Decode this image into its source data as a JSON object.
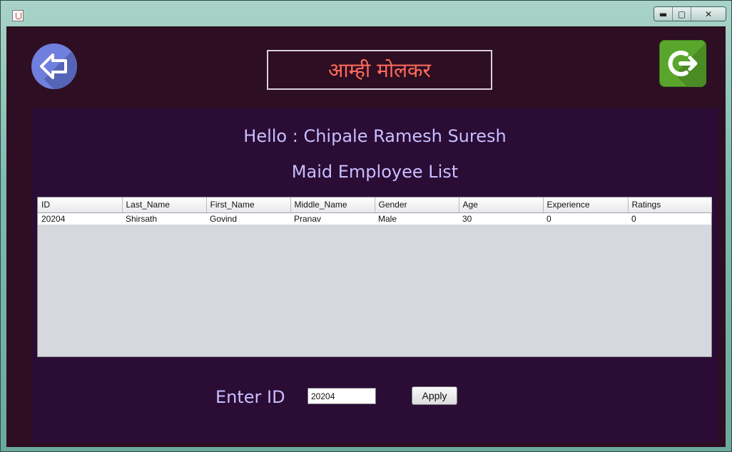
{
  "window": {
    "controls": {
      "minimize": "▬",
      "maximize": "▢",
      "close": "✕"
    },
    "accent_bg": "#2e0e22"
  },
  "header": {
    "title": "आम्ही मोलकर",
    "back_icon": "back-arrow-icon",
    "exit_icon": "exit-power-icon"
  },
  "main": {
    "greeting": "Hello : Chipale Ramesh Suresh",
    "list_title": "Maid Employee List",
    "table": {
      "columns": [
        "ID",
        "Last_Name",
        "First_Name",
        "Middle_Name",
        "Gender",
        "Age",
        "Experience",
        "Ratings"
      ],
      "rows": [
        [
          "20204",
          "Shirsath",
          "Govind",
          "Pranav",
          "Male",
          "30",
          "0",
          "0"
        ]
      ]
    },
    "enter_id_label": "Enter ID",
    "id_value": "20204",
    "apply_label": "Apply"
  },
  "colors": {
    "title_text": "#ff6b5a",
    "label_text": "#c9bfff",
    "panel_bg": "#2a0c35",
    "exit_green": "#5aa62c",
    "back_blue": "#6f7fde"
  }
}
